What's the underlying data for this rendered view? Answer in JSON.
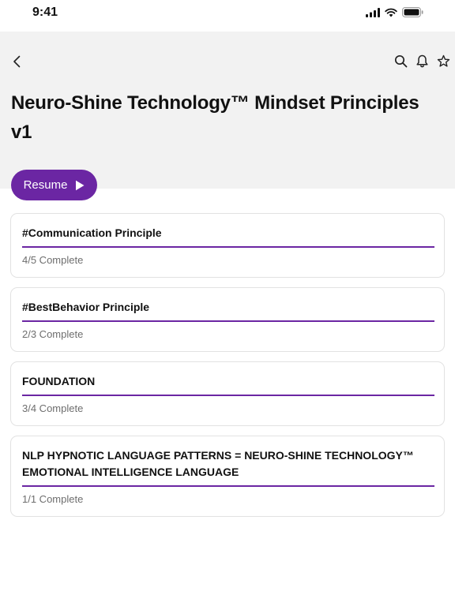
{
  "status_bar": {
    "time": "9:41"
  },
  "header": {
    "title": "Neuro-Shine Technology™ Mindset Principles v1",
    "resume_label": "Resume"
  },
  "icons": {
    "back": "chevron-left-icon",
    "search": "search-icon",
    "notifications": "bell-icon",
    "favorite": "star-icon",
    "resume": "play-icon"
  },
  "colors": {
    "accent": "#6b26a3",
    "header_bg": "#f2f2f2"
  },
  "courses": [
    {
      "title": "#Communication Principle",
      "status": "4/5 Complete",
      "progress": 1.0
    },
    {
      "title": "#BestBehavior Principle",
      "status": "2/3 Complete",
      "progress": 1.0
    },
    {
      "title": "FOUNDATION",
      "status": "3/4 Complete",
      "progress": 1.0
    },
    {
      "title": "NLP HYPNOTIC LANGUAGE PATTERNS = NEURO-SHINE TECHNOLOGY™ EMOTIONAL INTELLIGENCE LANGUAGE",
      "status": "1/1 Complete",
      "progress": 1.0
    }
  ]
}
